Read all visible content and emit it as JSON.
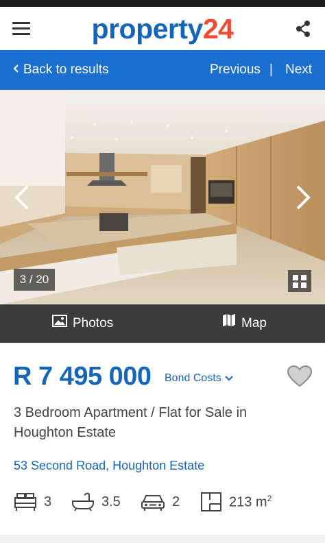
{
  "header": {
    "logo_part1": "property",
    "logo_part2": "24",
    "menu_icon": "hamburger-menu-icon",
    "share_icon": "share-icon"
  },
  "navbar": {
    "back_label": "Back to results",
    "previous_label": "Previous",
    "separator": "|",
    "next_label": "Next"
  },
  "gallery": {
    "counter": "3 / 20",
    "prev_icon": "chevron-left-icon",
    "next_icon": "chevron-right-icon",
    "grid_icon": "grid-view-icon"
  },
  "tabs": {
    "photos_label": "Photos",
    "map_label": "Map"
  },
  "listing": {
    "price": "R 7 495 000",
    "bond_costs_label": "Bond Costs",
    "title": "3 Bedroom Apartment / Flat for Sale in Houghton Estate",
    "address": "53 Second Road, Houghton Estate",
    "bedrooms": "3",
    "bathrooms": "3.5",
    "garages": "2",
    "floor_size": "213 m",
    "floor_unit_sup": "2"
  },
  "colors": {
    "brand_blue": "#1566b9",
    "nav_blue": "#1b6fd0",
    "logo_red": "#ef4d33",
    "tab_bar": "#3c3c3c"
  }
}
